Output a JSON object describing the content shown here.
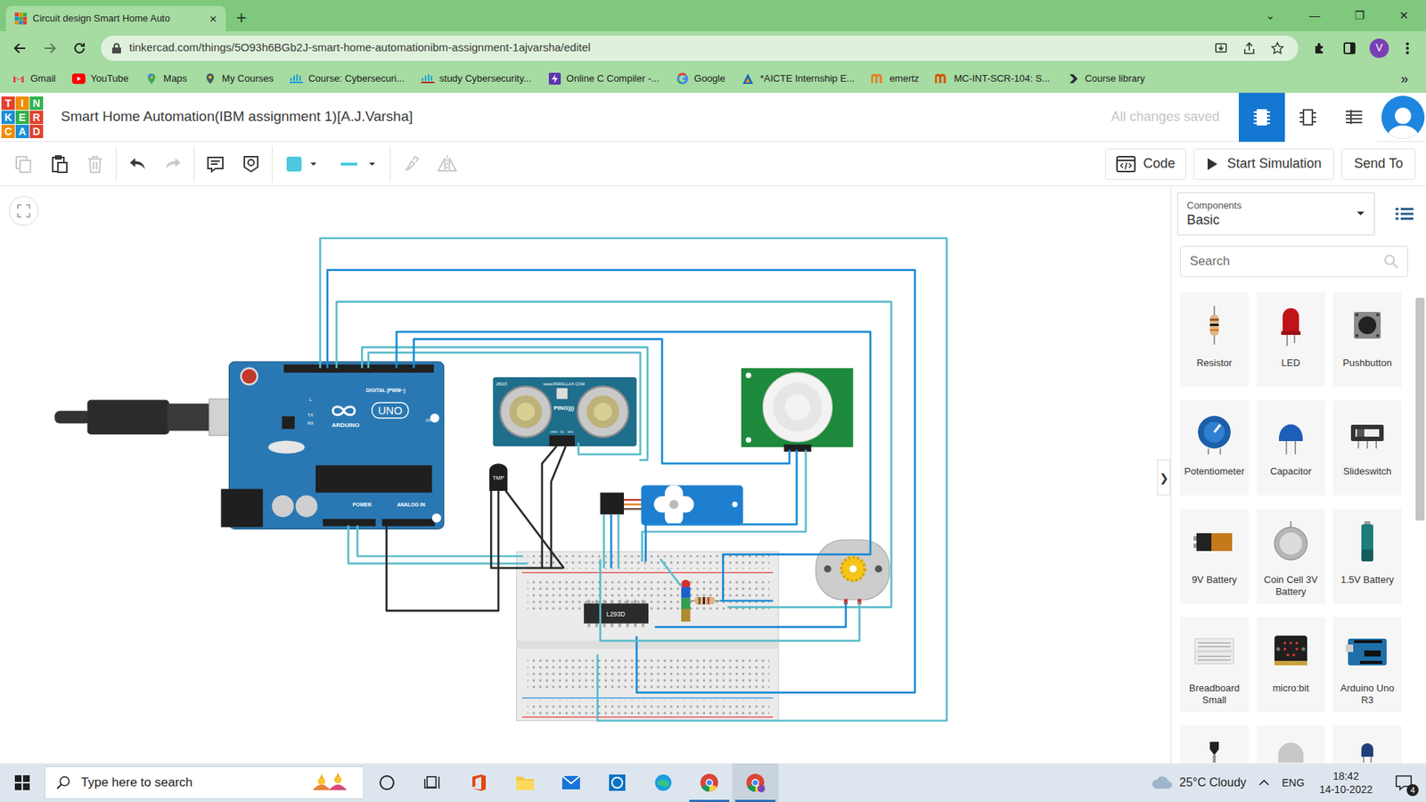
{
  "browser": {
    "tab": {
      "title": "Circuit design Smart Home Auto",
      "close": "×",
      "selected": true
    },
    "new_tab": "+",
    "window_controls": [
      "⌄",
      "—",
      "❐",
      "✕"
    ],
    "url": "tinkercad.com/things/5O93h6BGb2J-smart-home-automationibm-assignment-1ajvarsha/editel",
    "profile": "V",
    "bookmarks": [
      {
        "label": "Gmail"
      },
      {
        "label": "YouTube"
      },
      {
        "label": "Maps"
      },
      {
        "label": "My Courses"
      },
      {
        "label": "Course: Cybersecuri..."
      },
      {
        "label": "study Cybersecurity..."
      },
      {
        "label": "Online C Compiler -..."
      },
      {
        "label": "Google"
      },
      {
        "label": "*AICTE Internship E..."
      },
      {
        "label": "emertz"
      },
      {
        "label": "MC-INT-SCR-104: S..."
      },
      {
        "label": "Course library"
      }
    ],
    "bookmarks_more": "»"
  },
  "app": {
    "logo": [
      "T",
      "I",
      "N",
      "K",
      "E",
      "R",
      "C",
      "A",
      "D"
    ],
    "title": "Smart Home Automation(IBM assignment 1)[A.J.Varsha]",
    "save_status": "All changes saved",
    "views": [
      {
        "selected": true
      },
      {
        "selected": false
      },
      {
        "selected": false
      }
    ]
  },
  "toolbar": {
    "tools": [
      {
        "disabled": true
      },
      {
        "disabled": false
      },
      {
        "disabled": true
      },
      {
        "disabled": false
      },
      {
        "disabled": true
      },
      {
        "disabled": false
      },
      {
        "disabled": false
      },
      {
        "disabled": false
      },
      {
        "disabled": false
      },
      {
        "disabled": true
      },
      {
        "disabled": true
      }
    ],
    "code": "Code",
    "simulate": "Start Simulation",
    "send": "Send To"
  },
  "canvas": {
    "arduino": {
      "brand": "ARDUINO",
      "model": "UNO",
      "digital": "DIGITAL (PWM~)",
      "power": "POWER",
      "analog": "ANALOG IN",
      "on": "ON",
      "l": "L",
      "tx": "TX",
      "rx": "RX"
    },
    "ultrasonic": {
      "label": "PING)))",
      "site": "www.PARALLAX.COM",
      "part": "28015",
      "pins": [
        "GND",
        "5V",
        "SIG"
      ]
    },
    "tmp": "TMP",
    "chip": "L293D"
  },
  "panel": {
    "collapse": "❯",
    "dropdown_label": "Components",
    "dropdown_value": "Basic",
    "search_placeholder": "Search",
    "components": [
      {
        "label": "Resistor"
      },
      {
        "label": "LED"
      },
      {
        "label": "Pushbutton"
      },
      {
        "label": "Potentiometer"
      },
      {
        "label": "Capacitor"
      },
      {
        "label": "Slideswitch"
      },
      {
        "label": "9V Battery"
      },
      {
        "label": "Coin Cell 3V Battery"
      },
      {
        "label": "1.5V Battery"
      },
      {
        "label": "Breadboard Small"
      },
      {
        "label": "micro:bit"
      },
      {
        "label": "Arduino Uno R3"
      }
    ]
  },
  "taskbar": {
    "search": "Type here to search",
    "weather": "25°C Cloudy",
    "lang": "ENG",
    "time": "18:42",
    "date": "14-10-2022",
    "notifications": "4"
  }
}
